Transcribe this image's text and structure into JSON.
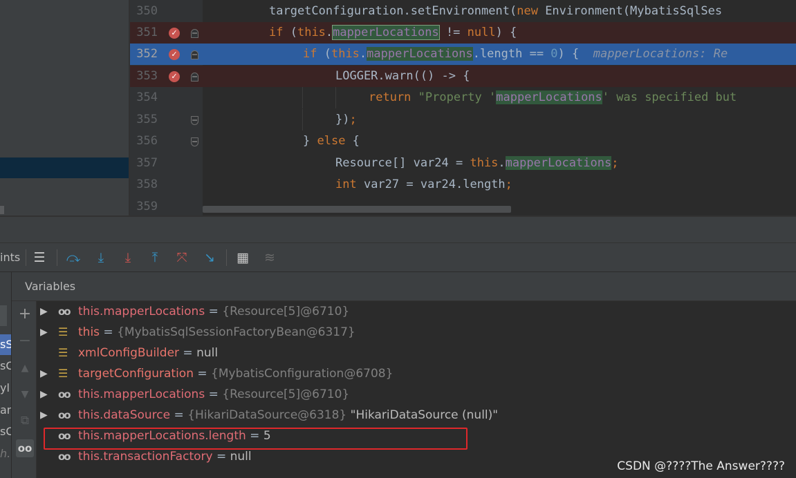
{
  "editor": {
    "lines": [
      {
        "num": "350",
        "text": "targetConfiguration.setEnvironment(new Environment(MybatisSqlSes"
      },
      {
        "num": "351",
        "text": "if (this.mapperLocations != null) {"
      },
      {
        "num": "352",
        "text": "if (this.mapperLocations.length == 0) {",
        "hint": "mapperLocations: Re"
      },
      {
        "num": "353",
        "text": "LOGGER.warn(() -> {"
      },
      {
        "num": "354",
        "text": "return \"Property 'mapperLocations' was specified but"
      },
      {
        "num": "355",
        "text": "});"
      },
      {
        "num": "356",
        "text": "} else {"
      },
      {
        "num": "357",
        "text": "Resource[] var24 = this.mapperLocations;"
      },
      {
        "num": "358",
        "text": "int var27 = var24.length;"
      },
      {
        "num": "359",
        "text": ""
      }
    ],
    "tokens": {
      "l350_a": "targetConfiguration.setEnvironment(",
      "l350_new": "new",
      "l350_b": " Environment(MybatisSqlSes",
      "l351_if": "if",
      "l351_a": " (",
      "l351_this": "this",
      "l351_dot": ".",
      "l351_fld": "mapperLocations",
      "l351_b": " != ",
      "l351_null": "null",
      "l351_c": ") {",
      "l352_if": "if",
      "l352_a": " (",
      "l352_this": "this",
      "l352_dot": ".",
      "l352_fld": "mapperLocations",
      "l352_b": ".length == ",
      "l352_zero": "0",
      "l352_c": ") {  ",
      "l352_hint": "mapperLocations: Re",
      "l353_a": "LOGGER.warn(() -> {",
      "l354_ret": "return",
      "l354_s1": " \"Property '",
      "l354_fld": "mapperLocations",
      "l354_s2": "' was specified but",
      "l355_a": "})",
      "l355_b": ";",
      "l356_a": "} ",
      "l356_else": "else",
      "l356_b": " {",
      "l357_a": "Resource[] var24 = ",
      "l357_this": "this",
      "l357_dot": ".",
      "l357_fld": "mapperLocations",
      "l357_semi": ";",
      "l358_int": "int",
      "l358_a": " var27 = var24.length",
      "l358_semi": ";"
    }
  },
  "toolbar": {
    "left_fragment": "ints",
    "icons": [
      "menu-icon",
      "step-over-icon",
      "step-into-icon",
      "force-step-into-icon",
      "step-out-icon",
      "drop-frame-icon",
      "run-to-cursor-icon",
      "evaluate-expression-icon",
      "trace-icon"
    ]
  },
  "frames_fragments": [
    "sS",
    "sC",
    "yl",
    "an",
    "sC",
    "h.("
  ],
  "variables": {
    "title": "Variables",
    "items": [
      {
        "expandable": true,
        "icon": "watch-icon",
        "name": "this.mapperLocations",
        "eq": " = ",
        "value": "{Resource[5]@6710}"
      },
      {
        "expandable": true,
        "icon": "field-icon",
        "name": "this",
        "eq": " = ",
        "value": "{MybatisSqlSessionFactoryBean@6317}"
      },
      {
        "expandable": false,
        "icon": "field-icon",
        "name": "xmlConfigBuilder",
        "eq": " = ",
        "value": "null"
      },
      {
        "expandable": true,
        "icon": "field-icon",
        "name": "targetConfiguration",
        "eq": " = ",
        "value": "{MybatisConfiguration@6708}"
      },
      {
        "expandable": true,
        "icon": "watch-icon",
        "name": "this.mapperLocations",
        "eq": " = ",
        "value": "{Resource[5]@6710}"
      },
      {
        "expandable": true,
        "icon": "watch-icon",
        "name": "this.dataSource",
        "eq": " = ",
        "value": "{HikariDataSource@6318}",
        "extra": " \"HikariDataSource (null)\""
      },
      {
        "expandable": false,
        "icon": "watch-icon",
        "name": "this.mapperLocations.length",
        "eq": " = ",
        "value": "5"
      },
      {
        "expandable": false,
        "icon": "watch-icon",
        "name": "this.transactionFactory",
        "eq": " = ",
        "value": "null"
      }
    ]
  },
  "watermark": "CSDN @????The Answer????",
  "colors": {
    "breakpoint": "#c75450",
    "current_line": "#2d5d9f",
    "highlight_box": "#e0282b",
    "var_name": "#e06c75"
  }
}
